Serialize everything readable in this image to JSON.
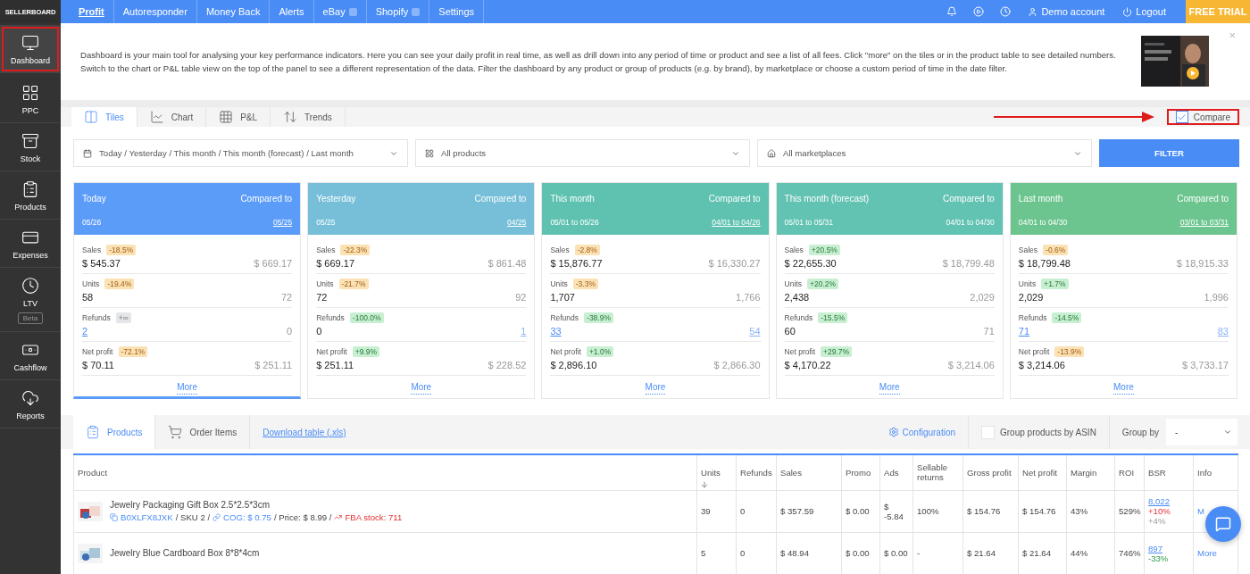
{
  "topbar": {
    "logo": "SELLERBOARD",
    "nav": [
      {
        "label": "Profit",
        "selected": true,
        "badge": false
      },
      {
        "label": "Autoresponder",
        "selected": false,
        "badge": false
      },
      {
        "label": "Money Back",
        "selected": false,
        "badge": false
      },
      {
        "label": "Alerts",
        "selected": false,
        "badge": false
      },
      {
        "label": "eBay",
        "selected": false,
        "badge": true
      },
      {
        "label": "Shopify",
        "selected": false,
        "badge": true
      },
      {
        "label": "Settings",
        "selected": false,
        "badge": false
      }
    ],
    "account": "Demo account",
    "logout": "Logout",
    "trial": "FREE TRIAL"
  },
  "sidebar": {
    "items": [
      {
        "label": "Dashboard",
        "selected": true
      },
      {
        "label": "PPC",
        "selected": false
      },
      {
        "label": "Stock",
        "selected": false
      },
      {
        "label": "Products",
        "selected": false
      },
      {
        "label": "Expenses",
        "selected": false
      },
      {
        "label": "LTV",
        "selected": false,
        "tag": "Beta"
      },
      {
        "label": "Cashflow",
        "selected": false
      },
      {
        "label": "Reports",
        "selected": false
      }
    ]
  },
  "info": {
    "text": "Dashboard is your main tool for analysing your key performance indicators. Here you can see your daily profit in real time, as well as drill down into any period of time or product and see a list of all fees. Click \"more\" on the tiles or in the product table to see detailed numbers. Switch to the chart or P&L table view on the top of the panel to see a different representation of the data. Filter the dashboard by any product or group of products (e.g. by brand), by marketplace or choose a custom period of time in the date filter.",
    "close": "×"
  },
  "tabs": [
    {
      "label": "Tiles",
      "selected": true
    },
    {
      "label": "Chart",
      "selected": false
    },
    {
      "label": "P&L",
      "selected": false
    },
    {
      "label": "Trends",
      "selected": false
    }
  ],
  "compare": {
    "label": "Compare",
    "checked": true
  },
  "filters": {
    "period": "Today / Yesterday / This month / This month (forecast) / Last month",
    "products": "All products",
    "marketplaces": "All marketplaces",
    "button": "FILTER"
  },
  "tiles": [
    {
      "title": "Today",
      "date": "05/26",
      "compared_label": "Compared to",
      "compared_date": "05/25",
      "compared_link": true,
      "color": "#5b9cf8",
      "selected": true,
      "more": "More",
      "metrics": [
        {
          "label": "Sales",
          "badge": "-18.5%",
          "kind": "down",
          "value": "$ 545.37",
          "value_link": false,
          "compare": "$ 669.17",
          "compare_link": false
        },
        {
          "label": "Units",
          "badge": "-19.4%",
          "kind": "down",
          "value": "58",
          "value_link": false,
          "compare": "72",
          "compare_link": false
        },
        {
          "label": "Refunds",
          "badge": "+∞",
          "kind": "neutral",
          "value": "2",
          "value_link": true,
          "compare": "0",
          "compare_link": false
        },
        {
          "label": "Net profit",
          "badge": "-72.1%",
          "kind": "down",
          "value": "$ 70.11",
          "value_link": false,
          "compare": "$ 251.11",
          "compare_link": false
        }
      ]
    },
    {
      "title": "Yesterday",
      "date": "05/25",
      "compared_label": "Compared to",
      "compared_date": "04/25",
      "compared_link": true,
      "color": "#77bfd8",
      "selected": false,
      "more": "More",
      "metrics": [
        {
          "label": "Sales",
          "badge": "-22.3%",
          "kind": "down",
          "value": "$ 669.17",
          "value_link": false,
          "compare": "$ 861.48",
          "compare_link": false
        },
        {
          "label": "Units",
          "badge": "-21.7%",
          "kind": "down",
          "value": "72",
          "value_link": false,
          "compare": "92",
          "compare_link": false
        },
        {
          "label": "Refunds",
          "badge": "-100.0%",
          "kind": "up",
          "value": "0",
          "value_link": false,
          "compare": "1",
          "compare_link": true
        },
        {
          "label": "Net profit",
          "badge": "+9.9%",
          "kind": "up",
          "value": "$ 251.11",
          "value_link": false,
          "compare": "$ 228.52",
          "compare_link": false
        }
      ]
    },
    {
      "title": "This month",
      "date": "05/01 to 05/26",
      "compared_label": "Compared to",
      "compared_date": "04/01 to 04/26",
      "compared_link": true,
      "color": "#5fc2b1",
      "selected": false,
      "more": "More",
      "metrics": [
        {
          "label": "Sales",
          "badge": "-2.8%",
          "kind": "down",
          "value": "$ 15,876.77",
          "value_link": false,
          "compare": "$ 16,330.27",
          "compare_link": false
        },
        {
          "label": "Units",
          "badge": "-3.3%",
          "kind": "down",
          "value": "1,707",
          "value_link": false,
          "compare": "1,766",
          "compare_link": false
        },
        {
          "label": "Refunds",
          "badge": "-38.9%",
          "kind": "up",
          "value": "33",
          "value_link": true,
          "compare": "54",
          "compare_link": true
        },
        {
          "label": "Net profit",
          "badge": "+1.0%",
          "kind": "up",
          "value": "$ 2,896.10",
          "value_link": false,
          "compare": "$ 2,866.30",
          "compare_link": false
        }
      ]
    },
    {
      "title": "This month (forecast)",
      "date": "05/01 to 05/31",
      "compared_label": "Compared to",
      "compared_date": "04/01 to 04/30",
      "compared_link": false,
      "color": "#63c3b3",
      "selected": false,
      "more": "More",
      "metrics": [
        {
          "label": "Sales",
          "badge": "+20.5%",
          "kind": "up",
          "value": "$ 22,655.30",
          "value_link": false,
          "compare": "$ 18,799.48",
          "compare_link": false
        },
        {
          "label": "Units",
          "badge": "+20.2%",
          "kind": "up",
          "value": "2,438",
          "value_link": false,
          "compare": "2,029",
          "compare_link": false
        },
        {
          "label": "Refunds",
          "badge": "-15.5%",
          "kind": "up",
          "value": "60",
          "value_link": false,
          "compare": "71",
          "compare_link": false
        },
        {
          "label": "Net profit",
          "badge": "+29.7%",
          "kind": "up",
          "value": "$ 4,170.22",
          "value_link": false,
          "compare": "$ 3,214.06",
          "compare_link": false
        }
      ]
    },
    {
      "title": "Last month",
      "date": "04/01 to 04/30",
      "compared_label": "Compared to",
      "compared_date": "03/01 to 03/31",
      "compared_link": true,
      "color": "#6cc58e",
      "selected": false,
      "more": "More",
      "metrics": [
        {
          "label": "Sales",
          "badge": "-0.6%",
          "kind": "down",
          "value": "$ 18,799.48",
          "value_link": false,
          "compare": "$ 18,915.33",
          "compare_link": false
        },
        {
          "label": "Units",
          "badge": "+1.7%",
          "kind": "up",
          "value": "2,029",
          "value_link": false,
          "compare": "1,996",
          "compare_link": false
        },
        {
          "label": "Refunds",
          "badge": "-14.5%",
          "kind": "up",
          "value": "71",
          "value_link": true,
          "compare": "83",
          "compare_link": true
        },
        {
          "label": "Net profit",
          "badge": "-13.9%",
          "kind": "down",
          "value": "$ 3,214.06",
          "value_link": false,
          "compare": "$ 3,733.17",
          "compare_link": false
        }
      ]
    }
  ],
  "products": {
    "tabs": [
      {
        "label": "Products",
        "selected": true
      },
      {
        "label": "Order Items",
        "selected": false
      }
    ],
    "download": "Download table (.xls)",
    "configuration": "Configuration",
    "group_asin": {
      "label": "Group products by ASIN",
      "checked": false
    },
    "group_by": {
      "label": "Group by",
      "value": "-"
    },
    "table": {
      "columns": [
        {
          "label": "Product",
          "sorted": false
        },
        {
          "label": "Units",
          "sorted": true
        },
        {
          "label": "Refunds",
          "sorted": false
        },
        {
          "label": "Sales",
          "sorted": false
        },
        {
          "label": "Promo",
          "sorted": false
        },
        {
          "label": "Ads",
          "sorted": false
        },
        {
          "label": "Sellable returns",
          "sorted": false
        },
        {
          "label": "Gross profit",
          "sorted": false
        },
        {
          "label": "Net profit",
          "sorted": false
        },
        {
          "label": "Margin",
          "sorted": false
        },
        {
          "label": "ROI",
          "sorted": false
        },
        {
          "label": "BSR",
          "sorted": false
        },
        {
          "label": "Info",
          "sorted": false
        }
      ],
      "rows": [
        {
          "name": "Jewelry Packaging Gift Box 2.5*2.5*3cm",
          "meta": [
            {
              "kind": "asin",
              "text": "B0XLFX8JXK"
            },
            {
              "kind": "plain",
              "text": "/ SKU 2 /"
            },
            {
              "kind": "cog",
              "text": "COG: $ 0.75"
            },
            {
              "kind": "plain",
              "text": "/ Price: $ 8.99 /"
            },
            {
              "kind": "stock",
              "text": "FBA stock: 711"
            }
          ],
          "figures": [
            "39",
            "0",
            "$ 357.59",
            "$ 0.00",
            "$ -5.84",
            "100%",
            "$ 154.76",
            "$ 154.76",
            "43%",
            "529%"
          ],
          "bsr": "8,022",
          "bsr_changes": [
            {
              "text": "+10%",
              "kind": "bad"
            },
            {
              "text": "+4%",
              "kind": "neutral"
            }
          ],
          "info": "M"
        },
        {
          "name": "Jewelry Blue Cardboard Box 8*8*4cm",
          "figures": [
            "5",
            "0",
            "$ 48.94",
            "$ 0.00",
            "$ 0.00",
            "-",
            "$ 21.64",
            "$ 21.64",
            "44%",
            "746%"
          ],
          "bsr": "897",
          "bsr_changes": [
            {
              "text": "-33%",
              "kind": "good"
            }
          ],
          "info": "More"
        }
      ]
    }
  }
}
